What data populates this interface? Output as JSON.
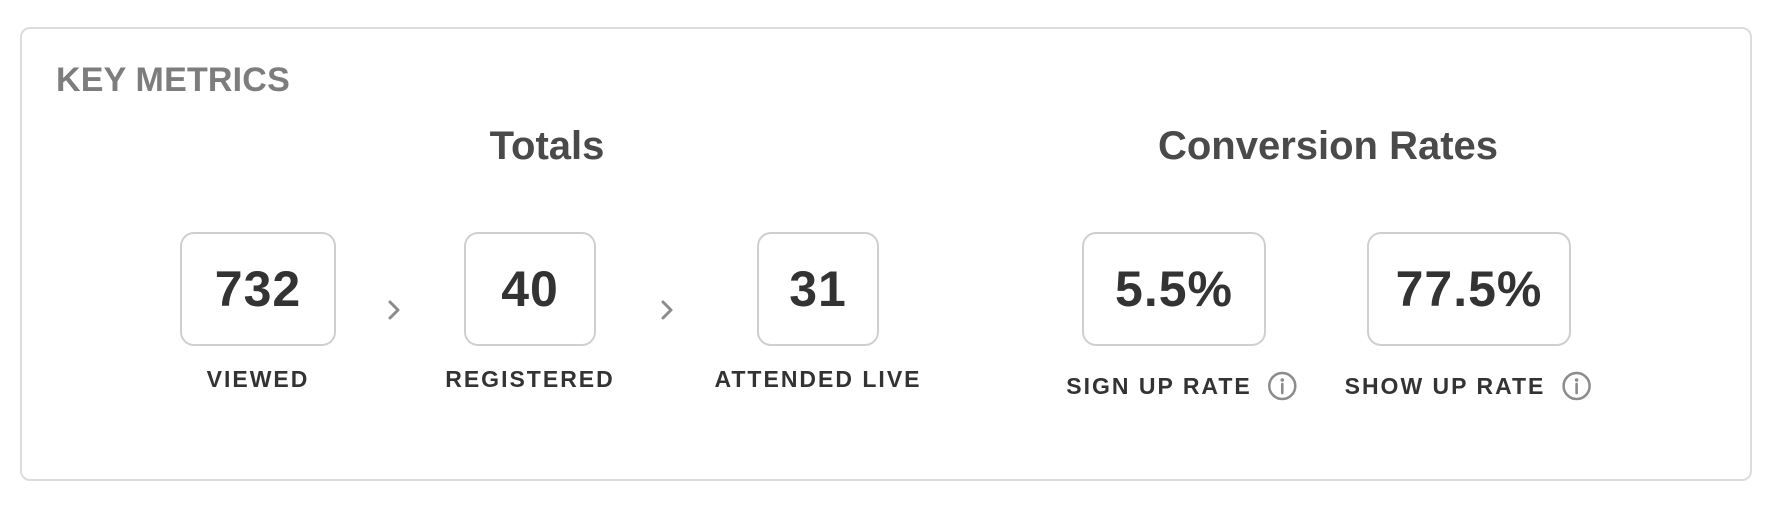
{
  "card": {
    "title": "KEY METRICS"
  },
  "totals": {
    "title": "Totals",
    "metrics": [
      {
        "value": "732",
        "label": "VIEWED"
      },
      {
        "value": "40",
        "label": "REGISTERED"
      },
      {
        "value": "31",
        "label": "ATTENDED LIVE"
      }
    ],
    "separator_icon": "chevron-right-icon"
  },
  "conversion": {
    "title": "Conversion Rates",
    "metrics": [
      {
        "value": "5.5%",
        "label": "SIGN UP RATE",
        "icon": "info-icon"
      },
      {
        "value": "77.5%",
        "label": "SHOW UP RATE",
        "icon": "info-icon"
      }
    ]
  },
  "colors": {
    "border": "#dcdcdc",
    "box_border": "#cfcfcf",
    "title_gray": "#7d7d7d",
    "text_dark": "#333333",
    "icon_gray": "#8c8c8c"
  }
}
